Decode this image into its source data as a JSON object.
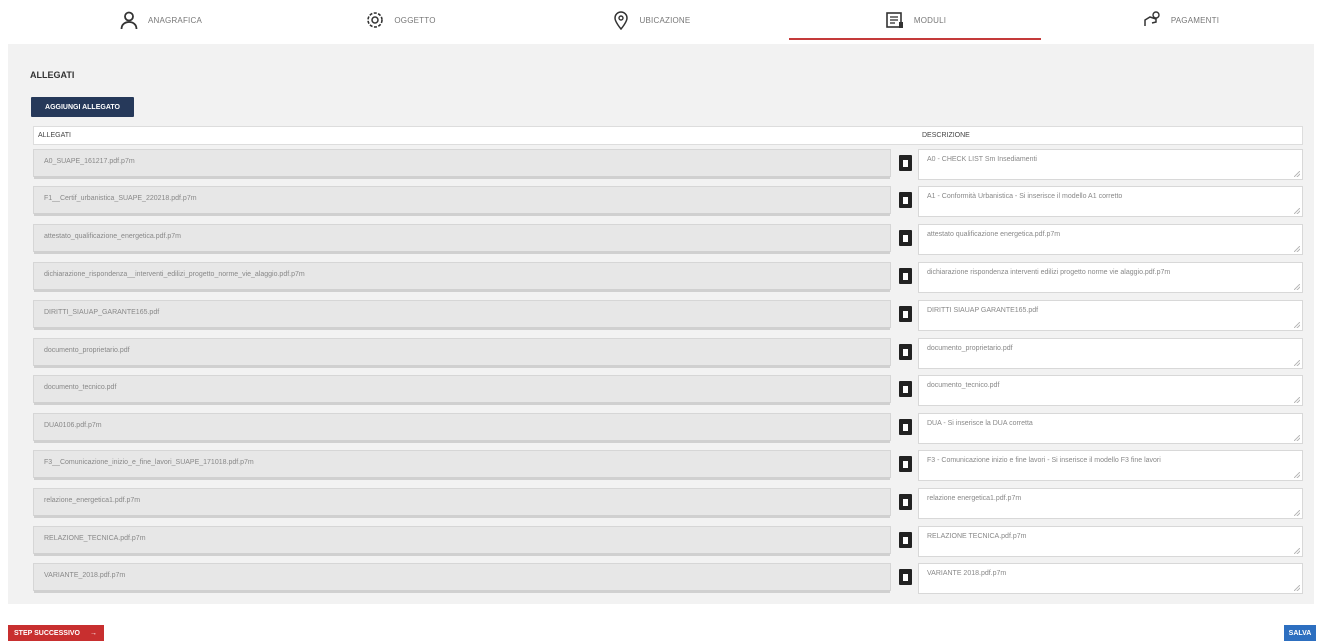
{
  "tabs": [
    {
      "label": "ANAGRAFICA",
      "icon": "person-icon"
    },
    {
      "label": "OGGETTO",
      "icon": "gear-icon"
    },
    {
      "label": "UBICAZIONE",
      "icon": "map-pin-icon"
    },
    {
      "label": "MODULI",
      "icon": "document-icon",
      "active": true
    },
    {
      "label": "PAGAMENTI",
      "icon": "hand-coin-icon"
    }
  ],
  "section": {
    "title": "ALLEGATI",
    "add_button": "AGGIUNGI ALLEGATO"
  },
  "table": {
    "headers": {
      "file": "ALLEGATI",
      "description": "DESCRIZIONE"
    },
    "rows": [
      {
        "file": "A0_SUAPE_161217.pdf.p7m",
        "description": "A0 - CHECK LIST Sm Insediamenti"
      },
      {
        "file": "F1__Certif_urbanistica_SUAPE_220218.pdf.p7m",
        "description": "A1 - Conformità Urbanistica - Si inserisce il modello A1 corretto"
      },
      {
        "file": "attestato_qualificazione_energetica.pdf.p7m",
        "description": "attestato qualificazione energetica.pdf.p7m"
      },
      {
        "file": "dichiarazione_rispondenza__interventi_edilizi_progetto_norme_vie_alaggio.pdf.p7m",
        "description": "dichiarazione rispondenza interventi edilizi progetto norme vie alaggio.pdf.p7m"
      },
      {
        "file": "DIRITTI_SIAUAP_GARANTE165.pdf",
        "description": "DIRITTI SIAUAP GARANTE165.pdf"
      },
      {
        "file": "documento_proprietario.pdf",
        "description": "documento_proprietario.pdf"
      },
      {
        "file": "documento_tecnico.pdf",
        "description": "documento_tecnico.pdf"
      },
      {
        "file": "DUA0106.pdf.p7m",
        "description": "DUA - Si inserisce la DUA corretta"
      },
      {
        "file": "F3__Comunicazione_inizio_e_fine_lavori_SUAPE_171018.pdf.p7m",
        "description": "F3 - Comunicazione inizio e fine lavori - Si inserisce il modello F3 fine lavori"
      },
      {
        "file": "relazione_energetica1.pdf.p7m",
        "description": "relazione energetica1.pdf.p7m"
      },
      {
        "file": "RELAZIONE_TECNICA.pdf.p7m",
        "description": "RELAZIONE TECNICA.pdf.p7m"
      },
      {
        "file": "VARIANTE_2018.pdf.p7m",
        "description": "VARIANTE 2018.pdf.p7m"
      }
    ]
  },
  "footer": {
    "next_label": "STEP SUCCESSIVO",
    "next_arrow": "→",
    "save_label": "SALVA",
    "save_icon": "save-icon"
  }
}
